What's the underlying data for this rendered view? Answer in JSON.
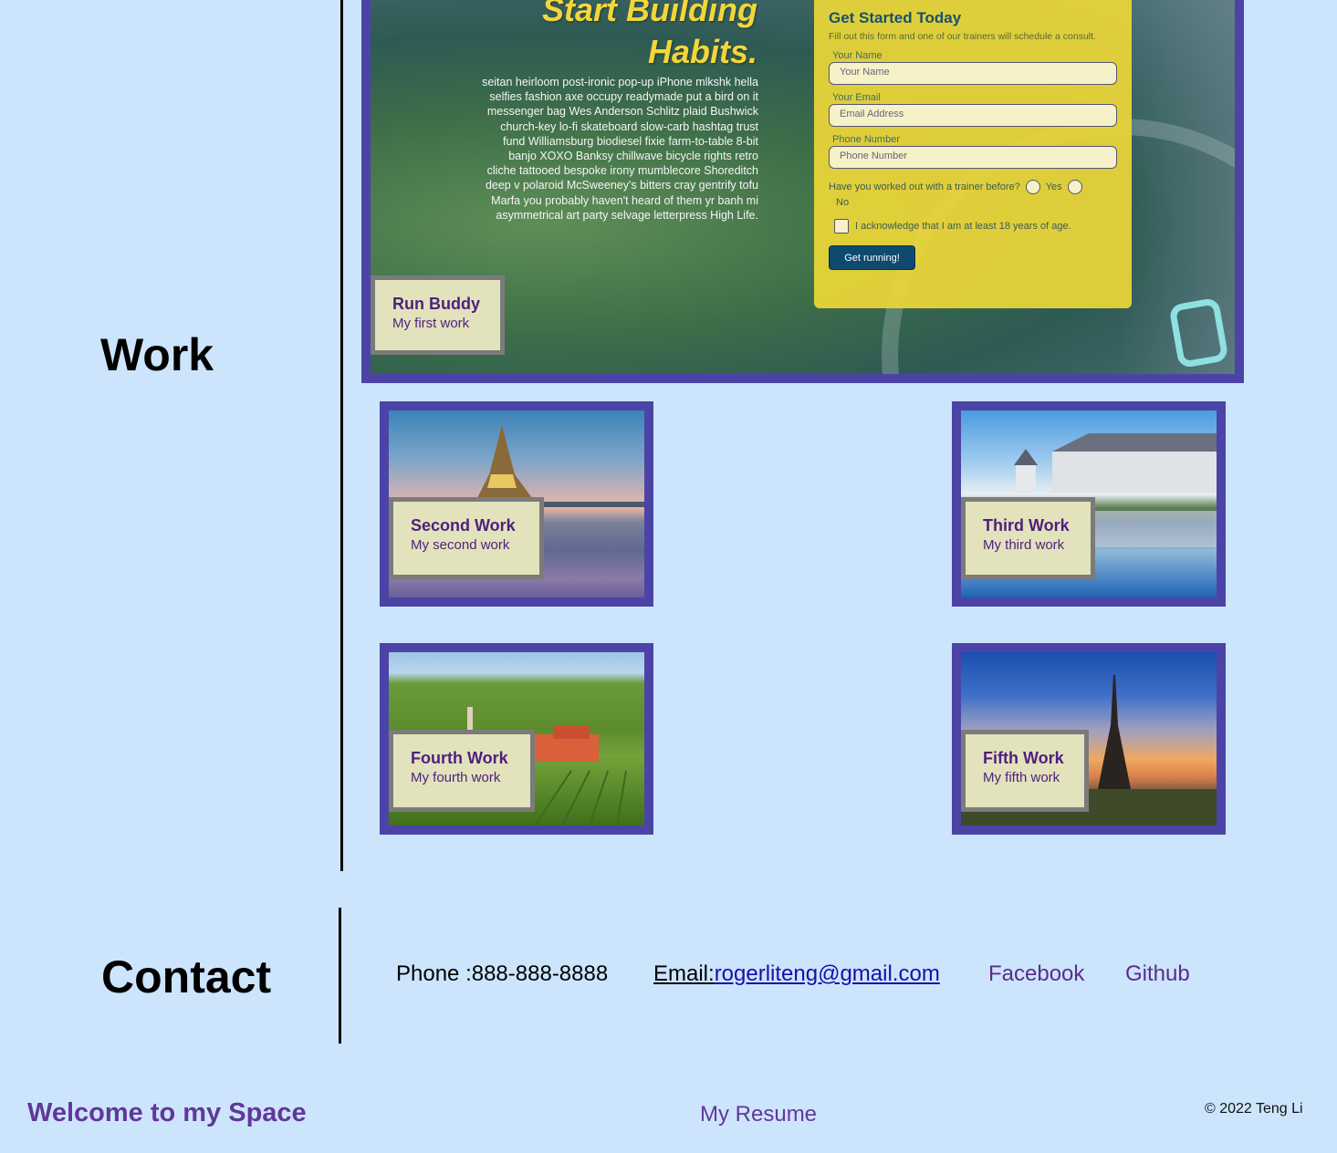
{
  "work": {
    "heading": "Work",
    "project1": {
      "hero_title_line1": "Start Building",
      "hero_title_line2": "Habits.",
      "hero_body": "seitan heirloom post-ironic pop-up iPhone mlkshk hella selfies fashion axe occupy readymade put a bird on it messenger bag Wes Anderson Schlitz plaid Bushwick church-key lo-fi skateboard slow-carb hashtag trust fund Williamsburg biodiesel fixie farm-to-table 8-bit banjo XOXO Banksy chillwave bicycle rights retro cliche tattooed bespoke irony mumblecore Shoreditch deep v polaroid McSweeney's bitters cray gentrify tofu Marfa you probably haven't heard of them yr banh mi asymmetrical art party selvage letterpress High Life.",
      "form": {
        "heading": "Get Started Today",
        "subtitle": "Fill out this form and one of our trainers will schedule a consult.",
        "name_label": "Your Name",
        "name_placeholder": "Your Name",
        "email_label": "Your Email",
        "email_placeholder": "Email Address",
        "phone_label": "Phone Number",
        "phone_placeholder": "Phone Number",
        "trainer_question": "Have you worked out with a trainer before?",
        "yes_label": "Yes",
        "no_label": "No",
        "age_ack": "I acknowledge that I am at least 18 years of age.",
        "submit_label": "Get running!"
      },
      "caption_title": "Run Buddy",
      "caption_sub": "My first work"
    },
    "thumbnails": [
      {
        "title": "Second Work",
        "sub": "My second work"
      },
      {
        "title": "Third Work",
        "sub": "My third work"
      },
      {
        "title": "Fourth Work",
        "sub": "My fourth work"
      },
      {
        "title": "Fifth Work",
        "sub": "My fifth work"
      }
    ]
  },
  "contact": {
    "heading": "Contact",
    "phone": "Phone :888-888-8888",
    "email_prefix": "Email:",
    "email_address": "rogerliteng@gmail.com",
    "facebook": "Facebook",
    "github": "Github"
  },
  "footer": {
    "brand": "Welcome to my Space",
    "resume": "My Resume",
    "copyright": "© 2022 Teng Li"
  },
  "colors": {
    "background": "#cce5fd",
    "frame": "#4b44a6",
    "caption_bg": "#e2e2bc",
    "caption_text": "#4f1f7e",
    "footer_text": "#62379a"
  }
}
